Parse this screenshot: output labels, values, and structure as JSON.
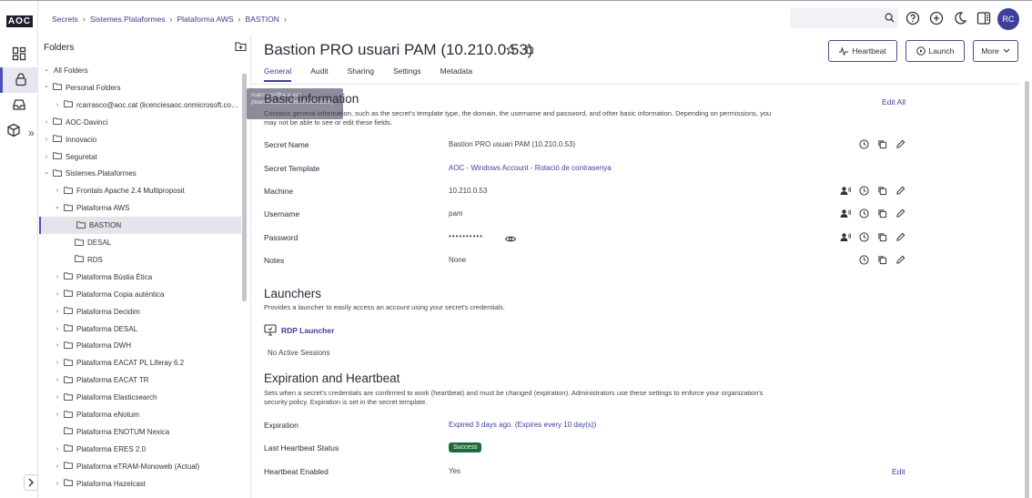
{
  "logo": "AOC",
  "breadcrumb": [
    "Secrets",
    "Sistemes.Plataformes",
    "Plataforma AWS",
    "BASTION"
  ],
  "user_initials": "RC",
  "folders": {
    "title": "Folders",
    "tooltip": "rcarrasco@aoc.cat (licenciesaoc.onmicrosoft.com)",
    "tree": [
      {
        "label": "All Folders",
        "depth": 0,
        "chevron": "down"
      },
      {
        "label": "Personal Folders",
        "depth": 0,
        "chevron": "down"
      },
      {
        "label": "rcarrasco@aoc.cat (licenciesaoc.onmicrosoft.co…",
        "depth": 1,
        "chevron": "right"
      },
      {
        "label": "AOC-Davinci",
        "depth": 0,
        "chevron": "right"
      },
      {
        "label": "Innovacio",
        "depth": 0,
        "chevron": "right"
      },
      {
        "label": "Seguretat",
        "depth": 0,
        "chevron": "right"
      },
      {
        "label": "Sistemes.Plataformes",
        "depth": 0,
        "chevron": "down"
      },
      {
        "label": "Frontals Apache 2.4 Multiproposit",
        "depth": 1,
        "chevron": "right"
      },
      {
        "label": "Plataforma AWS",
        "depth": 1,
        "chevron": "down"
      },
      {
        "label": "BASTION",
        "depth": 2,
        "chevron": "",
        "selected": true
      },
      {
        "label": "DESAL",
        "depth": 2,
        "chevron": ""
      },
      {
        "label": "RDS",
        "depth": 2,
        "chevron": ""
      },
      {
        "label": "Plataforma Bústia Ètica",
        "depth": 1,
        "chevron": "right"
      },
      {
        "label": "Plataforma Copia autèntica",
        "depth": 1,
        "chevron": "right"
      },
      {
        "label": "Plataforma Decidim",
        "depth": 1,
        "chevron": "right"
      },
      {
        "label": "Plataforma DESAL",
        "depth": 1,
        "chevron": "right"
      },
      {
        "label": "Plataforma DWH",
        "depth": 1,
        "chevron": "right"
      },
      {
        "label": "Plataforma EACAT PL Liferay 6.2",
        "depth": 1,
        "chevron": "right"
      },
      {
        "label": "Plataforma EACAT TR",
        "depth": 1,
        "chevron": "right"
      },
      {
        "label": "Plataforma Elasticsearch",
        "depth": 1,
        "chevron": "right"
      },
      {
        "label": "Plataforma eNotum",
        "depth": 1,
        "chevron": "right"
      },
      {
        "label": "Plataforma ENOTUM Nexica",
        "depth": 1,
        "chevron": ""
      },
      {
        "label": "Plataforma ERES 2.0",
        "depth": 1,
        "chevron": "right"
      },
      {
        "label": "Plataforma eTRAM-Monoweb (Actual)",
        "depth": 1,
        "chevron": "right"
      },
      {
        "label": "Plataforma Hazelcast",
        "depth": 1,
        "chevron": "right"
      }
    ]
  },
  "secret": {
    "title": "Bastion PRO usuari PAM (10.210.0.53)",
    "buttons": {
      "heartbeat": "Heartbeat",
      "launch": "Launch",
      "more": "More"
    },
    "tabs": [
      "General",
      "Audit",
      "Sharing",
      "Settings",
      "Metadata"
    ],
    "basic": {
      "title": "Basic Information",
      "desc": "Contains general information, such as the secret's template type, the domain, the username and password, and other basic information. Depending on permissions, you may not be able to see or edit these fields.",
      "edit_all": "Edit All",
      "fields": [
        {
          "label": "Secret Name",
          "value": "Bastion PRO usuari PAM (10.210.0.53)"
        },
        {
          "label": "Secret Template",
          "value": "AOC - Windows Account - Rotació de contrasenya"
        },
        {
          "label": "Machine",
          "value": "10.210.0.53"
        },
        {
          "label": "Username",
          "value": "pam"
        },
        {
          "label": "Password",
          "value": "••••••••••"
        },
        {
          "label": "Notes",
          "value": "None"
        }
      ]
    },
    "launchers": {
      "title": "Launchers",
      "desc": "Provides a launcher to easily access an account using your secret's credentials.",
      "rdp": "RDP Launcher",
      "sessions": "No Active Sessions"
    },
    "expiration": {
      "title": "Expiration and Heartbeat",
      "desc": "Sets when a secret's credentials are confirmed to work (heartbeat) and must be changed (expiration). Administrators use these settings to enforce your organization's security policy. Expiration is set in the secret template.",
      "fields": [
        {
          "label": "Expiration",
          "value": "Expired 3 days ago. (Expires every 10 day(s))"
        },
        {
          "label": "Last Heartbeat Status",
          "value": "Success"
        },
        {
          "label": "Heartbeat Enabled",
          "value": "Yes"
        }
      ],
      "edit": "Edit"
    }
  }
}
